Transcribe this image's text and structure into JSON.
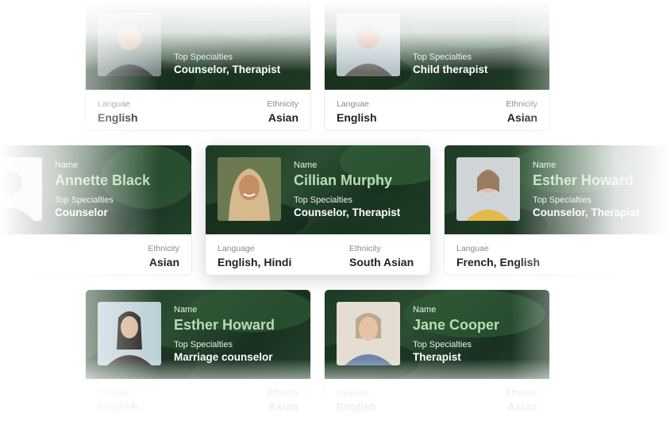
{
  "labels": {
    "name": "Name",
    "specialties": "Top Specialties",
    "language": "Language",
    "language_alt": "Languae",
    "ethnicity": "Ethnicity"
  },
  "cards": {
    "top_left": {
      "specialty": "Counselor, Therapist",
      "language": "English",
      "ethnicity": "Asian"
    },
    "top_right": {
      "specialty": "Child therapist",
      "language": "English",
      "ethnicity": "Asian"
    },
    "mid_left": {
      "name": "Annette Black",
      "specialty": "Counselor",
      "ethnicity": "Asian"
    },
    "center": {
      "name": "Cillian Murphy",
      "specialty": "Counselor, Therapist",
      "language": "English, Hindi",
      "ethnicity": "South Asian"
    },
    "mid_right": {
      "name": "Esther Howard",
      "specialty": "Counselor, Therapist",
      "language": "French, English"
    },
    "bottom_left": {
      "name": "Esther Howard",
      "specialty": "Marriage counselor",
      "language": "English",
      "ethnicity": "Asian"
    },
    "bottom_right": {
      "name": "Jane Cooper",
      "specialty": "Therapist",
      "language": "English",
      "ethnicity": "Asian"
    }
  },
  "colors": {
    "banner_green": "#24432b",
    "name_green": "#b9dcb4",
    "text_dark": "#222222",
    "label_gray": "#8a8a8a"
  }
}
